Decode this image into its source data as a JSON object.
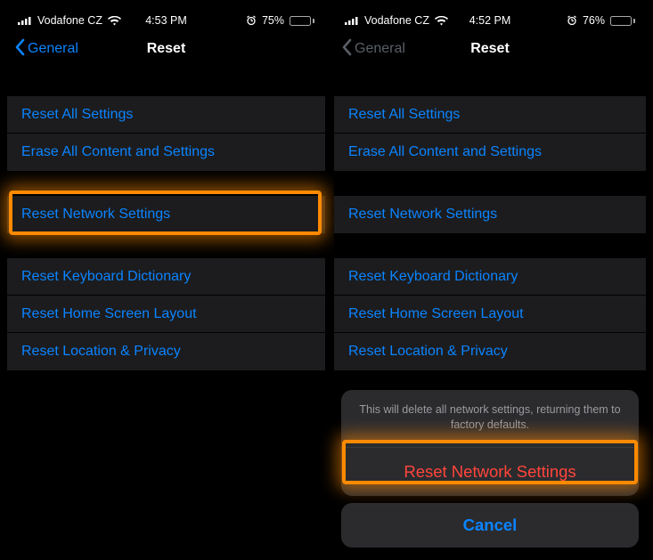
{
  "left": {
    "status": {
      "carrier": "Vodafone CZ",
      "time": "4:53 PM",
      "battery_text": "75%",
      "battery_pct": 75
    },
    "nav": {
      "back_label": "General",
      "title": "Reset"
    },
    "group1": [
      "Reset All Settings",
      "Erase All Content and Settings"
    ],
    "group2": [
      "Reset Network Settings"
    ],
    "group3": [
      "Reset Keyboard Dictionary",
      "Reset Home Screen Layout",
      "Reset Location & Privacy"
    ]
  },
  "right": {
    "status": {
      "carrier": "Vodafone CZ",
      "time": "4:52 PM",
      "battery_text": "76%",
      "battery_pct": 76
    },
    "nav": {
      "back_label": "General",
      "title": "Reset"
    },
    "group1": [
      "Reset All Settings",
      "Erase All Content and Settings"
    ],
    "group2": [
      "Reset Network Settings"
    ],
    "group3": [
      "Reset Keyboard Dictionary",
      "Reset Home Screen Layout",
      "Reset Location & Privacy"
    ],
    "sheet": {
      "message": "This will delete all network settings, returning them to factory defaults.",
      "destructive": "Reset Network Settings",
      "cancel": "Cancel"
    }
  }
}
